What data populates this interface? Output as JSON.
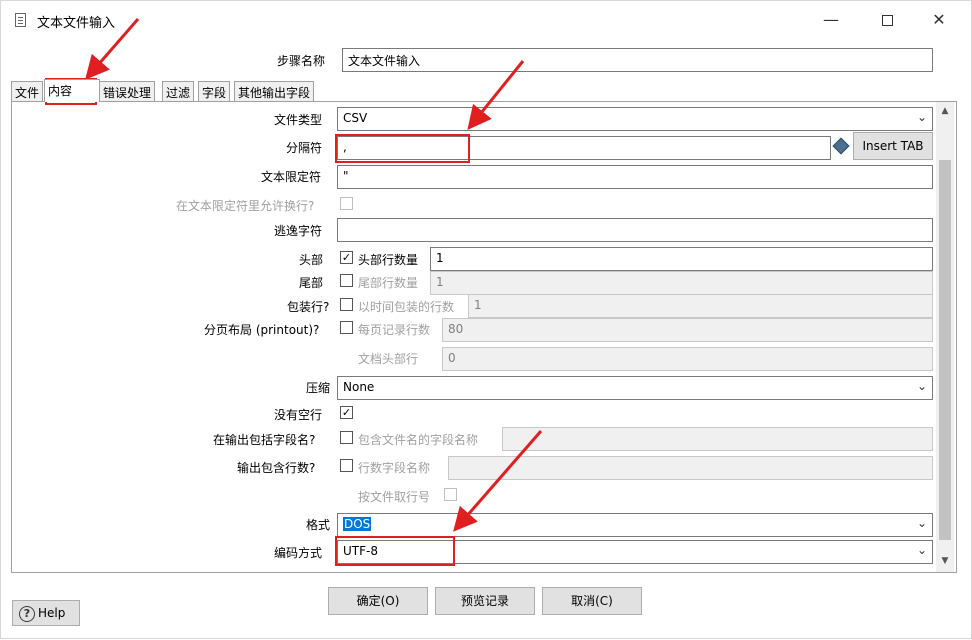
{
  "window": {
    "title": "文本文件输入",
    "minimize": "—",
    "close": "✕"
  },
  "step_name": {
    "label": "步骤名称",
    "value": "文本文件输入"
  },
  "tabs": [
    {
      "label": "文件"
    },
    {
      "label": "内容"
    },
    {
      "label": "错误处理"
    },
    {
      "label": "过滤"
    },
    {
      "label": "字段"
    },
    {
      "label": "其他输出字段"
    }
  ],
  "content": {
    "file_type": {
      "label": "文件类型",
      "value": "CSV"
    },
    "separator": {
      "label": "分隔符",
      "value": ",",
      "insert_tab": "Insert TAB"
    },
    "enclosure": {
      "label": "文本限定符",
      "value": "\""
    },
    "allow_breaks": {
      "label": "在文本限定符里允许换行?"
    },
    "escape": {
      "label": "逃逸字符",
      "value": ""
    },
    "header": {
      "label": "头部",
      "checked": true,
      "sub_label": "头部行数量",
      "value": "1"
    },
    "footer": {
      "label": "尾部",
      "checked": false,
      "sub_label": "尾部行数量",
      "value": "1"
    },
    "wrapped": {
      "label": "包装行?",
      "checked": false,
      "sub_label": "以时间包装的行数",
      "value": "1"
    },
    "paged": {
      "label": "分页布局 (printout)?",
      "checked": false,
      "sub_label": "每页记录行数",
      "value": "80"
    },
    "doc_header": {
      "label": "文档头部行",
      "value": "0"
    },
    "compression": {
      "label": "压缩",
      "value": "None"
    },
    "no_empty_rows": {
      "label": "没有空行",
      "checked": true
    },
    "include_filename": {
      "label": "在输出包括字段名?",
      "checked": false,
      "sub_label": "包含文件名的字段名称",
      "value": ""
    },
    "include_rownum": {
      "label": "输出包含行数?",
      "checked": false,
      "sub_label": "行数字段名称",
      "value": ""
    },
    "rownum_by_file": {
      "label": "按文件取行号"
    },
    "format": {
      "label": "格式",
      "value": "DOS"
    },
    "encoding": {
      "label": "编码方式",
      "value": "UTF-8"
    }
  },
  "buttons": {
    "ok": "确定(O)",
    "preview": "预览记录",
    "cancel": "取消(C)",
    "help": "Help",
    "help_icon": "?"
  },
  "glyphs": {
    "check": "✓",
    "dropdown": "⌄",
    "scroll_up": "▲",
    "scroll_down": "▼"
  },
  "colors": {
    "annotation_red": "#e02020",
    "selection_blue": "#0078d7"
  }
}
